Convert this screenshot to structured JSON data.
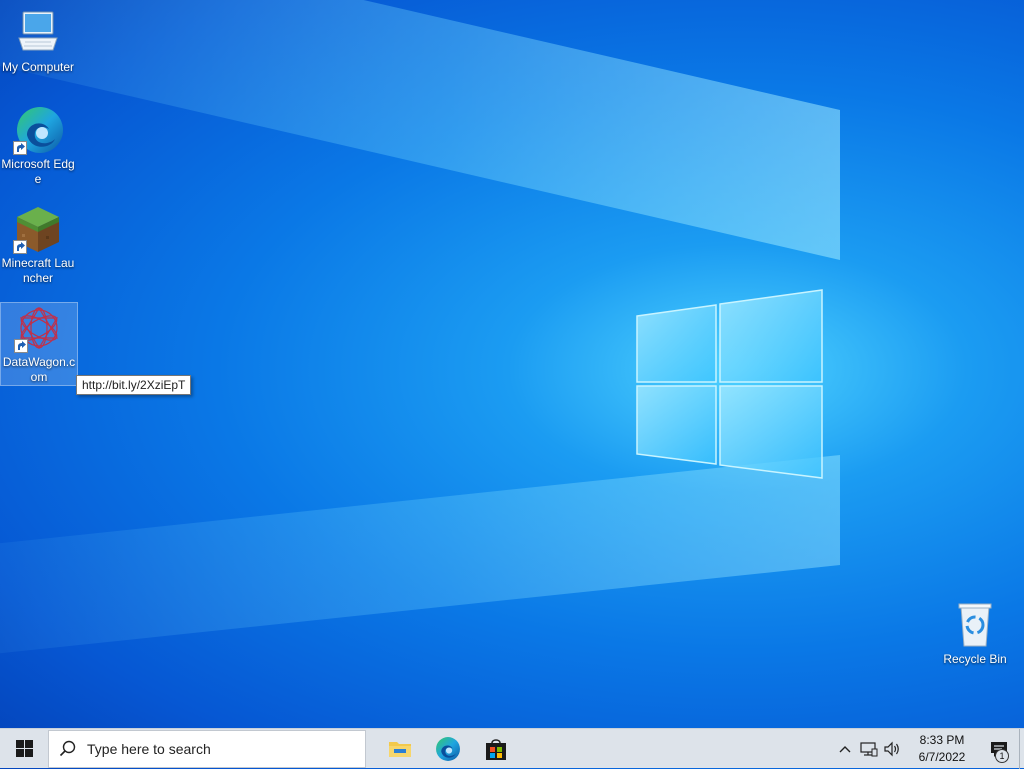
{
  "desktop": {
    "icons": [
      {
        "label": "My Computer",
        "icon": "computer-icon"
      },
      {
        "label": "Microsoft Edge",
        "icon": "edge-icon"
      },
      {
        "label": "Minecraft Launcher",
        "icon": "minecraft-icon"
      },
      {
        "label": "DataWagon.com",
        "icon": "datawagon-icon"
      },
      {
        "label": "Recycle Bin",
        "icon": "recycle-bin-icon"
      }
    ],
    "tooltip": "http://bit.ly/2XziEpT"
  },
  "taskbar": {
    "search_placeholder": "Type here to search",
    "apps": [
      {
        "name": "File Explorer",
        "icon": "folder-icon"
      },
      {
        "name": "Microsoft Edge",
        "icon": "edge-icon"
      },
      {
        "name": "Microsoft Store",
        "icon": "store-icon"
      }
    ],
    "clock": {
      "time": "8:33 PM",
      "date": "6/7/2022"
    },
    "notification_count": "1"
  },
  "colors": {
    "wallpaper": "#0a78e6",
    "taskbar": "#dde3ea",
    "accent": "#0078d7"
  }
}
